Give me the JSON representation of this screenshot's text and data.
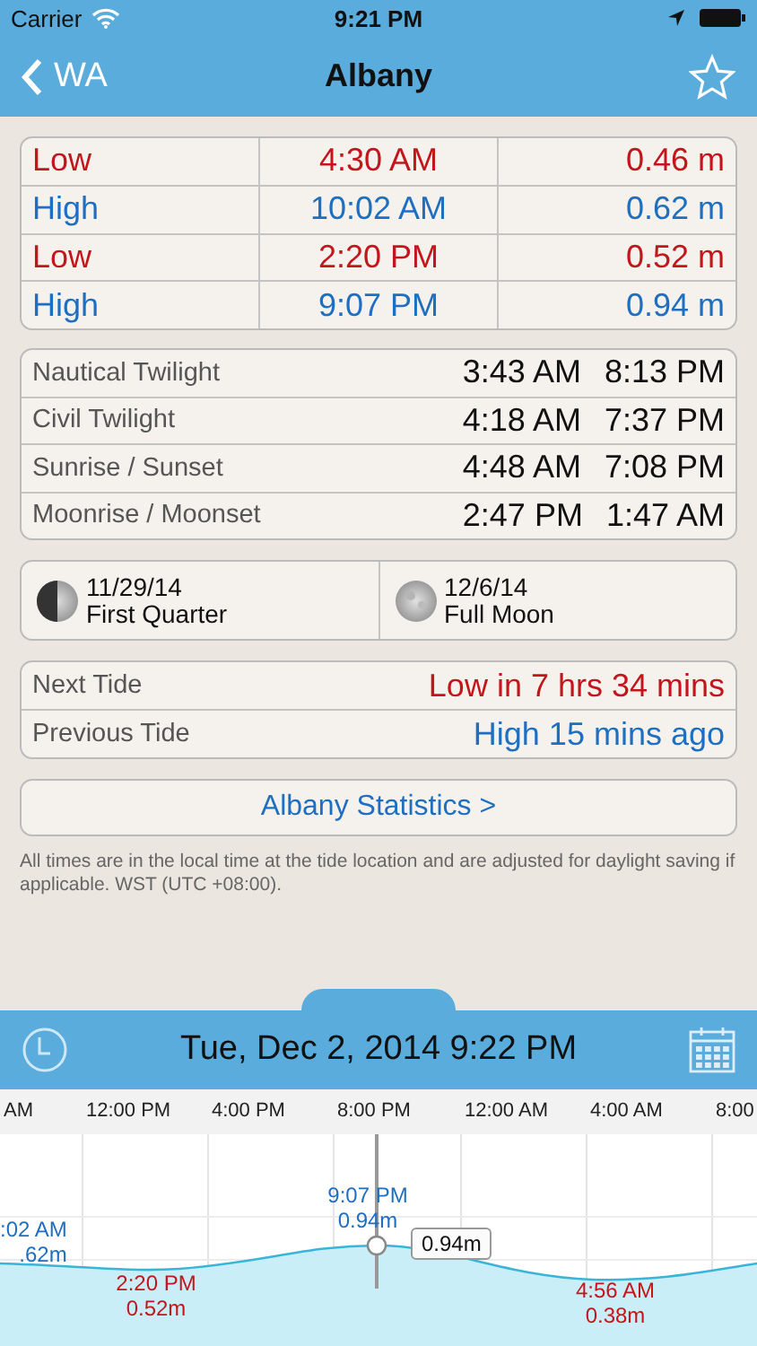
{
  "status_bar": {
    "carrier": "Carrier",
    "time": "9:21 PM"
  },
  "nav_bar": {
    "back": "WA",
    "title": "Albany",
    "starred": false
  },
  "tides": [
    {
      "kind": "low",
      "type": "Low",
      "time": "4:30 AM",
      "height": "0.46 m"
    },
    {
      "kind": "high",
      "type": "High",
      "time": "10:02 AM",
      "height": "0.62 m"
    },
    {
      "kind": "low",
      "type": "Low",
      "time": "2:20 PM",
      "height": "0.52 m"
    },
    {
      "kind": "high",
      "type": "High",
      "time": "9:07 PM",
      "height": "0.94 m"
    }
  ],
  "sun_moon": [
    {
      "label": "Nautical Twilight",
      "start": "3:43 AM",
      "end": "8:13 PM"
    },
    {
      "label": "Civil Twilight",
      "start": "4:18 AM",
      "end": "7:37 PM"
    },
    {
      "label": "Sunrise / Sunset",
      "start": "4:48 AM",
      "end": "7:08 PM"
    },
    {
      "label": "Moonrise / Moonset",
      "start": "2:47 PM",
      "end": "1:47 AM"
    }
  ],
  "moon_phases": [
    {
      "kind": "first_quarter",
      "date": "11/29/14",
      "name": "First Quarter"
    },
    {
      "kind": "full",
      "date": "12/6/14",
      "name": "Full Moon"
    }
  ],
  "tide_status": [
    {
      "kind": "low",
      "label": "Next Tide",
      "value": "Low in 7 hrs 34 mins"
    },
    {
      "kind": "high",
      "label": "Previous Tide",
      "value": "High 15 mins ago"
    }
  ],
  "statistics_button": "Albany Statistics >",
  "note": "All times are in the local time at the tide location and are adjusted for daylight saving if applicable. WST (UTC +08:00).",
  "date_bar": {
    "date_time": "Tue, Dec 2, 2014 9:22 PM"
  },
  "time_axis": [
    "AM",
    "12:00 PM",
    "4:00 PM",
    "8:00 PM",
    "12:00 AM",
    "4:00 AM",
    "8:00"
  ],
  "chart_labels": [
    {
      "kind": "high",
      "time": ":02 AM",
      "height": ".62m"
    },
    {
      "kind": "low",
      "time": "2:20 PM",
      "height": "0.52m"
    },
    {
      "kind": "high",
      "time": "9:07 PM",
      "height": "0.94m"
    },
    {
      "kind": "low",
      "time": "4:56 AM",
      "height": "0.38m"
    }
  ],
  "cursor_reading": "0.94m"
}
